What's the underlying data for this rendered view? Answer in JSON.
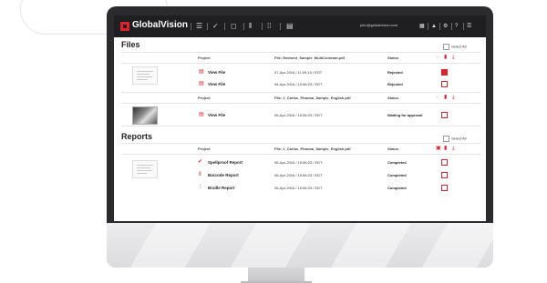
{
  "app": {
    "name": "GlobalVision",
    "user_email": "john@globalvision.com"
  },
  "files": {
    "title": "Files",
    "select_all": "Select All",
    "groups": [
      {
        "headers": {
          "project": "Project",
          "file": "File: Eminent_Sample_MultiColorant.pdf",
          "status": "Status"
        },
        "rows": [
          {
            "link": "View File",
            "date": "07-Apr-2016 / 11:09:15 / EDT",
            "status": "Rejected",
            "checked": true
          },
          {
            "link": "View File",
            "date": "06-Apr-2016 / 15:56:23 / EDT",
            "status": "Rejected",
            "checked": false
          }
        ]
      },
      {
        "headers": {
          "project": "Project",
          "file": "File: 1_Carlos_Pharma_Sample_English.pdf",
          "status": "Status"
        },
        "rows": [
          {
            "link": "View File",
            "date": "06-Apr-2016 / 15:56:23 / EDT",
            "status": "Waiting for approval",
            "checked": false
          }
        ]
      }
    ]
  },
  "reports": {
    "title": "Reports",
    "select_all": "Select All",
    "headers": {
      "project": "Project",
      "file": "File: 1_Carlos_Pharma_Sample_English.pdf",
      "status": "Status"
    },
    "rows": [
      {
        "link": "Spellproof Report",
        "icon": "spellcheck-icon",
        "date": "06-Apr-2016 / 15:56:23 / EDT",
        "status": "Completed"
      },
      {
        "link": "Barcode Report",
        "icon": "barcode-icon",
        "date": "06-Apr-2016 / 15:56:23 / EDT",
        "status": "Completed"
      },
      {
        "link": "Braille Report",
        "icon": "braille-icon",
        "date": "06-Apr-2016 / 15:56:23 / EDT",
        "status": "Completed"
      }
    ]
  },
  "colors": {
    "accent": "#d9232d",
    "topbar": "#1f1f22",
    "bezel": "#2b2b2e"
  }
}
